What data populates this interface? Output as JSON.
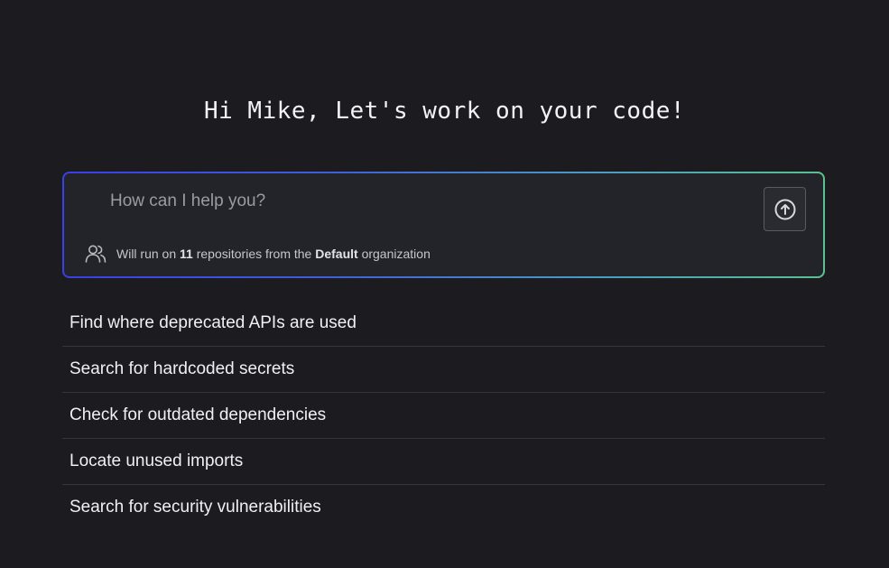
{
  "greeting": "Hi Mike, Let's work on your code!",
  "prompt": {
    "placeholder": "How can I help you?",
    "value": "",
    "send_icon": "arrow-up-circle-icon"
  },
  "scope": {
    "icon": "users-icon",
    "prefix": "Will run on ",
    "repo_count": "11",
    "middle": " repositories from the ",
    "organization": "Default",
    "suffix": " organization"
  },
  "suggestions": [
    "Find where deprecated APIs are used",
    "Search for hardcoded secrets",
    "Check for outdated dependencies",
    "Locate unused imports",
    "Search for security vulnerabilities"
  ],
  "colors": {
    "background": "#1c1c20",
    "panel": "#232429",
    "border_gradient_start": "#3a3fe6",
    "border_gradient_end": "#5cc08f"
  }
}
